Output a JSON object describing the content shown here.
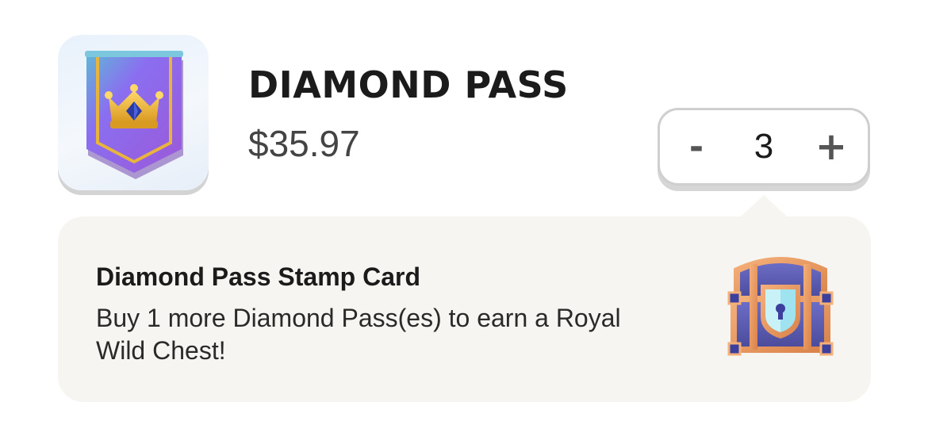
{
  "product": {
    "title": "DIAMOND PASS",
    "price": "$35.97",
    "icon": "diamond-pass-banner-icon"
  },
  "quantity": {
    "decrement_label": "-",
    "value": "3",
    "increment_label": "+"
  },
  "stamp_card": {
    "title": "Diamond Pass Stamp Card",
    "message": "Buy 1 more Diamond Pass(es) to earn a Royal Wild Chest!",
    "reward_icon": "royal-wild-chest-icon"
  },
  "colors": {
    "banner_purple": "#8a5cf0",
    "banner_teal": "#5fb8d6",
    "gold": "#e8b43c",
    "callout_bg": "#f6f5f1",
    "stepper_border": "#cfcfcf"
  }
}
